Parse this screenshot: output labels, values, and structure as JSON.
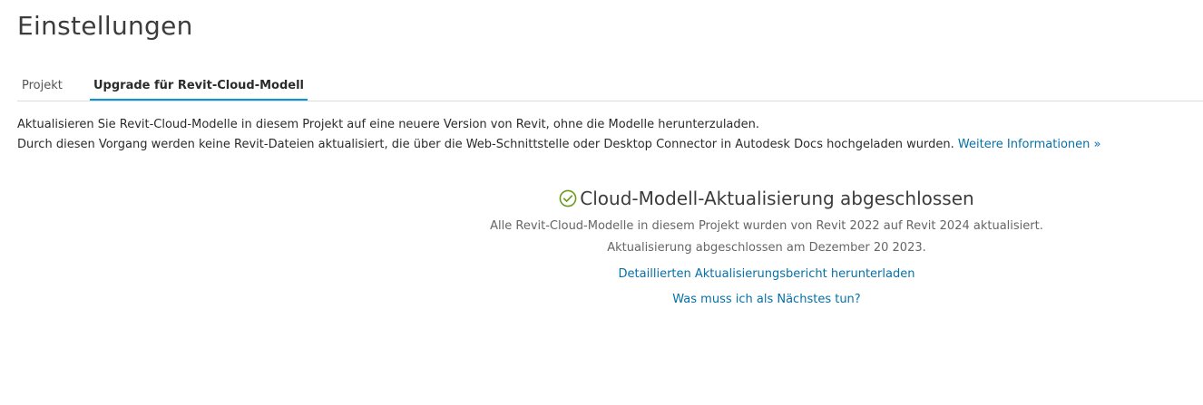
{
  "page": {
    "title": "Einstellungen"
  },
  "tabs": [
    {
      "label": "Projekt",
      "active": false
    },
    {
      "label": "Upgrade für Revit-Cloud-Modell",
      "active": true
    }
  ],
  "intro": {
    "line1": "Aktualisieren Sie Revit-Cloud-Modelle in diesem Projekt auf eine neuere Version von Revit, ohne die Modelle herunterzuladen.",
    "line2": "Durch diesen Vorgang werden keine Revit-Dateien aktualisiert, die über die Web-Schnittstelle oder Desktop Connector in Autodesk Docs hochgeladen wurden.",
    "more_link": "Weitere Informationen »"
  },
  "status": {
    "icon": "check-circle-icon",
    "icon_color": "#6a9a1f",
    "heading": "Cloud-Modell-Aktualisierung abgeschlossen",
    "summary": "Alle Revit-Cloud-Modelle in diesem Projekt wurden von Revit 2022 auf Revit 2024 aktualisiert.",
    "completed": "Aktualisierung abgeschlossen am Dezember 20 2023.",
    "download_link": "Detaillierten Aktualisierungsbericht herunterladen",
    "next_link": "Was muss ich als Nächstes tun?"
  },
  "colors": {
    "link": "#0670a8",
    "active_tab_underline": "#0696d7"
  }
}
